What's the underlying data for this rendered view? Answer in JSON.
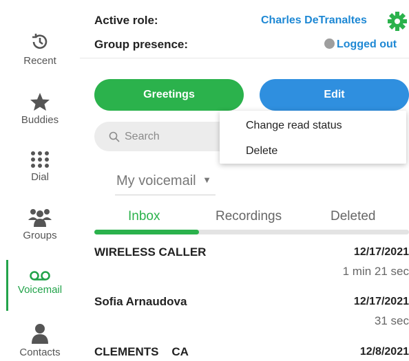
{
  "sidebar": {
    "items": [
      {
        "label": "Recent",
        "icon": "history-icon"
      },
      {
        "label": "Buddies",
        "icon": "star-icon"
      },
      {
        "label": "Dial",
        "icon": "dialpad-icon"
      },
      {
        "label": "Groups",
        "icon": "groups-icon"
      },
      {
        "label": "Voicemail",
        "icon": "voicemail-icon"
      },
      {
        "label": "Contacts",
        "icon": "contact-icon"
      }
    ],
    "active": "Voicemail"
  },
  "header": {
    "role_label": "Active role:",
    "role_value": "Charles DeTranaltes",
    "presence_label": "Group presence:",
    "presence_value": "Logged out"
  },
  "actions": {
    "greetings": "Greetings",
    "edit": "Edit"
  },
  "search": {
    "placeholder": "Search"
  },
  "menu": {
    "items": [
      "Change read status",
      "Delete"
    ]
  },
  "folder": {
    "selected": "My voicemail"
  },
  "tabs": {
    "items": [
      "Inbox",
      "Recordings",
      "Deleted"
    ],
    "active": "Inbox"
  },
  "voicemails": [
    {
      "caller": "WIRELESS CALLER",
      "date": "12/17/2021",
      "duration": "1 min 21 sec"
    },
    {
      "caller": "Sofia Arnaudova",
      "date": "12/17/2021",
      "duration": "31 sec"
    },
    {
      "caller": "CLEMENTS    CA",
      "date": "12/8/2021",
      "duration": ""
    }
  ],
  "colors": {
    "green": "#2bb24c",
    "blue": "#2f8fdf",
    "link_blue": "#1e88d4"
  }
}
